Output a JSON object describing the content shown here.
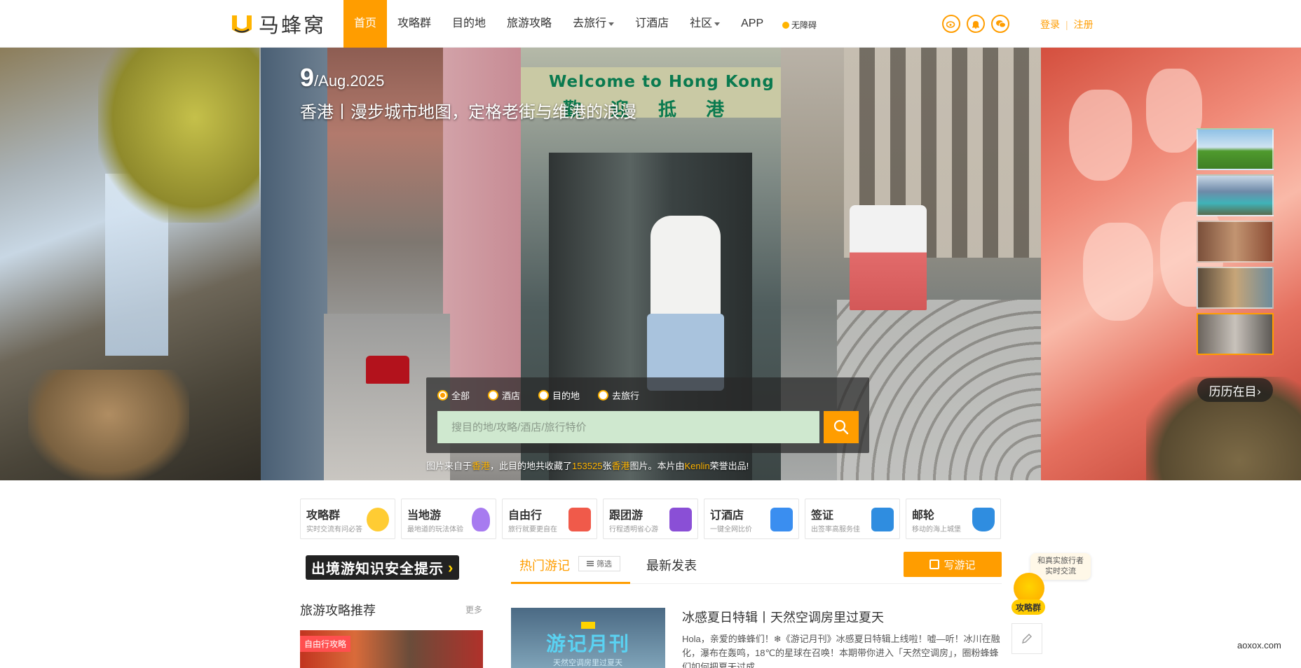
{
  "header": {
    "logo_text": "马蜂窝",
    "nav": [
      {
        "label": "首页",
        "active": true,
        "dropdown": false
      },
      {
        "label": "攻略群",
        "active": false,
        "dropdown": false
      },
      {
        "label": "目的地",
        "active": false,
        "dropdown": false
      },
      {
        "label": "旅游攻略",
        "active": false,
        "dropdown": false
      },
      {
        "label": "去旅行",
        "active": false,
        "dropdown": true
      },
      {
        "label": "订酒店",
        "active": false,
        "dropdown": false
      },
      {
        "label": "社区",
        "active": false,
        "dropdown": true
      },
      {
        "label": "APP",
        "active": false,
        "dropdown": false
      }
    ],
    "accessible_label": "无障碍",
    "social_icons": [
      "weibo-icon",
      "bell-icon",
      "wechat-icon"
    ],
    "login": "登录",
    "separator": "|",
    "register": "注册"
  },
  "hero": {
    "day": "9",
    "month_year": "/Aug.2025",
    "title": "香港丨漫步城市地图，定格老街与维港的浪漫",
    "sign_text": "Welcome to Hong Kong",
    "sign_cn": "歡迎抵港",
    "history_button": "历历在目›",
    "thumbnails": [
      {
        "name": "green-meadow",
        "active": false
      },
      {
        "name": "lake-mountain",
        "active": false
      },
      {
        "name": "temple",
        "active": false
      },
      {
        "name": "market-street",
        "active": false
      },
      {
        "name": "hongkong-street",
        "active": true
      }
    ]
  },
  "search": {
    "options": [
      {
        "label": "全部",
        "checked": true
      },
      {
        "label": "酒店",
        "checked": false
      },
      {
        "label": "目的地",
        "checked": false
      },
      {
        "label": "去旅行",
        "checked": false
      }
    ],
    "placeholder": "搜目的地/攻略/酒店/旅行特价"
  },
  "photo_credit": {
    "prefix": "图片来自于",
    "place": "香港",
    "mid": "，此目的地共收藏了",
    "count": "153525",
    "unit": "张",
    "place2": "香港",
    "suffix": "图片。本片由",
    "author": "Kenlin",
    "end": "荣誉出品!"
  },
  "categories": [
    {
      "name": "攻略群",
      "desc": "实时交流有问必答",
      "icon": "smiley-icon",
      "color": "#ffcc33"
    },
    {
      "name": "当地游",
      "desc": "最地道的玩法体验",
      "icon": "balloon-icon",
      "color": "#a77bf0"
    },
    {
      "name": "自由行",
      "desc": "旅行就要更自在",
      "icon": "gift-icon",
      "color": "#f05a4a"
    },
    {
      "name": "跟团游",
      "desc": "行程透明省心游",
      "icon": "flag-icon",
      "color": "#8a4fd6"
    },
    {
      "name": "订酒店",
      "desc": "一键全网比价",
      "icon": "hotel-icon",
      "color": "#3a8ef0"
    },
    {
      "name": "签证",
      "desc": "出签率高服务佳",
      "icon": "passport-icon",
      "color": "#2f8de0"
    },
    {
      "name": "邮轮",
      "desc": "移动的海上城堡",
      "icon": "ship-icon",
      "color": "#2f8de0"
    }
  ],
  "left": {
    "safety_banner": "出境游知识安全提示",
    "recommend_title": "旅游攻略推荐",
    "more": "更多",
    "tag": "自由行攻略"
  },
  "feed": {
    "tab_hot": "热门游记",
    "filter": "筛选",
    "tab_new": "最新发表",
    "write_button": "写游记",
    "cover_label": "游记月刊",
    "cover_sub": "天然空调房里过夏天",
    "title": "冰感夏日特辑丨天然空调房里过夏天",
    "body": "Hola，亲爱的蜂蜂们！❄《游记月刊》冰感夏日特辑上线啦！嘘—听！冰川在融化，瀑布在轰鸣，18℃的星球在召唤！本期带你进入「天然空调房」，圈粉蜂蜂们如何把夏天过成"
  },
  "floating": {
    "chat_tip_line1": "和真实旅行者",
    "chat_tip_line2": "实时交流",
    "mascot_label": "攻略群"
  },
  "watermark": "aoxox.com"
}
